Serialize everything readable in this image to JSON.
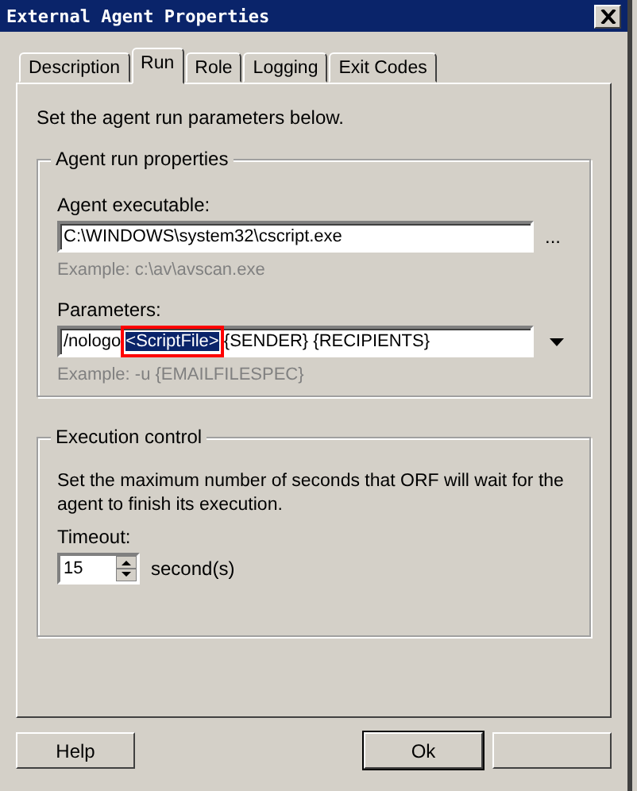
{
  "window": {
    "title": "External Agent Properties"
  },
  "tabs": [
    {
      "label": "Description",
      "selected": false
    },
    {
      "label": "Run",
      "selected": true
    },
    {
      "label": "Role",
      "selected": false
    },
    {
      "label": "Logging",
      "selected": false
    },
    {
      "label": "Exit Codes",
      "selected": false
    }
  ],
  "intro": "Set the agent run parameters below.",
  "run_group": {
    "title": "Agent run properties",
    "executable": {
      "label": "Agent executable:",
      "value": "C:\\WINDOWS\\system32\\cscript.exe",
      "browse": "...",
      "example": "Example: c:\\av\\avscan.exe"
    },
    "parameters": {
      "label": "Parameters:",
      "value_before": "/nologo ",
      "value_selected": "<ScriptFile>",
      "value_after": " {SENDER} {RECIPIENTS}",
      "example": "Example: -u {EMAILFILESPEC}",
      "highlighted": true
    }
  },
  "execution_group": {
    "title": "Execution control",
    "description": "Set the maximum number of seconds that ORF will wait for the agent to finish its execution.",
    "timeout_label": "Timeout:",
    "timeout_value": "15",
    "unit": "second(s)"
  },
  "buttons": [
    {
      "label": "Help",
      "default": false
    },
    {
      "label": "Ok",
      "default": true
    },
    {
      "default": false
    }
  ]
}
